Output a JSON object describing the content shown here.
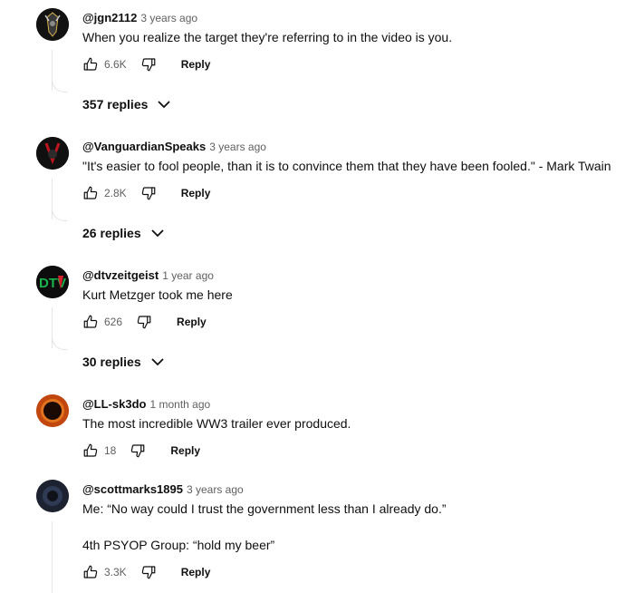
{
  "comments": [
    {
      "author": "@jgn2112",
      "time": "3 years ago",
      "text": "When you realize the target they're referring to in the video is you.",
      "likes": "6.6K",
      "reply_label": "Reply",
      "replies_label": "357 replies"
    },
    {
      "author": "@VanguardianSpeaks",
      "time": "3 years ago",
      "text": "\"It's easier to fool people, than it is to convince them that they have been fooled.\" - Mark Twain",
      "likes": "2.8K",
      "reply_label": "Reply",
      "replies_label": "26 replies"
    },
    {
      "author": "@dtvzeitgeist",
      "time": "1 year ago",
      "text": "Kurt Metzger took me here",
      "likes": "626",
      "reply_label": "Reply",
      "replies_label": "30 replies",
      "avatar_text": "DTV"
    },
    {
      "author": "@LL-sk3do",
      "time": "1 month ago",
      "text": "The most incredible WW3 trailer ever produced.",
      "likes": "18",
      "reply_label": "Reply"
    },
    {
      "author": "@scottmarks1895",
      "time": "3 years ago",
      "text_lines": [
        "Me: “No way could I trust the government less than I already do.”",
        "4th PSYOP Group: “hold my beer”"
      ],
      "likes": "3.3K",
      "reply_label": "Reply"
    }
  ],
  "icons": {
    "like": "thumb-up-icon",
    "dislike": "thumb-down-icon",
    "expand": "chevron-down-icon"
  }
}
